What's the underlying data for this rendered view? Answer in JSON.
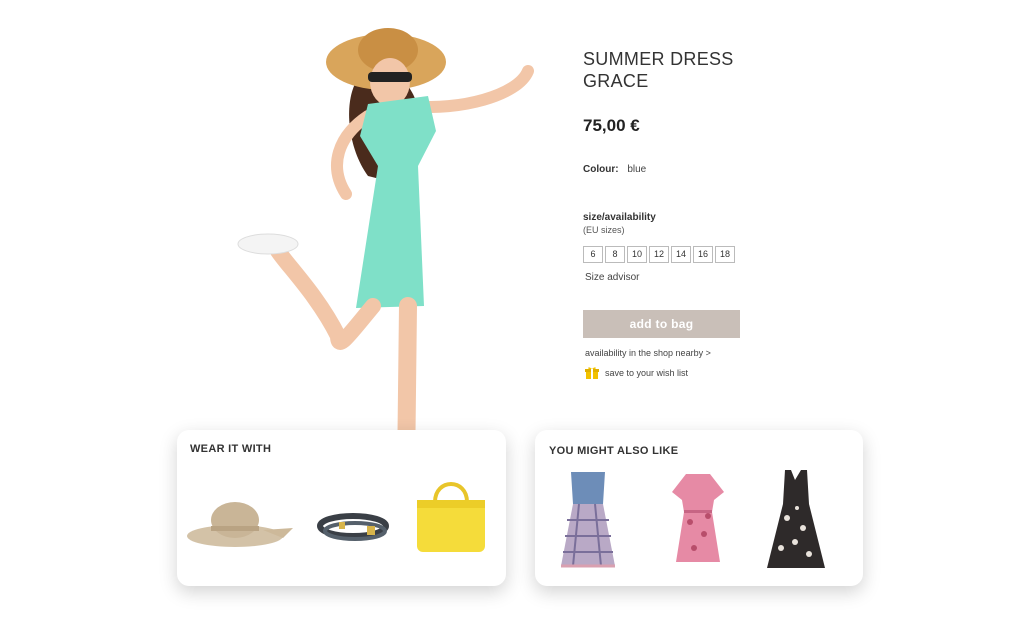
{
  "product": {
    "title": "SUMMER DRESS\nGRACE",
    "price": "75,00 €",
    "colour_label": "Colour:",
    "colour_value": "blue",
    "size_title": "size/availability",
    "size_subtitle": "(EU sizes)",
    "sizes": [
      "6",
      "8",
      "10",
      "12",
      "14",
      "16",
      "18"
    ],
    "size_advisor": "Size advisor",
    "add_to_bag": "add to bag",
    "availability_link": "availability in the shop nearby  >",
    "wish_list": "save to your wish list"
  },
  "wear_it_with": {
    "title": "WEAR IT WITH",
    "items": [
      {
        "icon": "straw-hat-icon"
      },
      {
        "icon": "belt-icon"
      },
      {
        "icon": "yellow-handbag-icon"
      }
    ]
  },
  "you_might_also_like": {
    "title": "YOU MIGHT ALSO LIKE",
    "items": [
      {
        "icon": "plaid-strapless-dress-icon"
      },
      {
        "icon": "pink-floral-dress-icon"
      },
      {
        "icon": "black-floral-dress-icon"
      }
    ]
  },
  "colors": {
    "button_bg": "#c9bfb8",
    "dress": "#7fe0c8",
    "wish_icon": "#f2c200",
    "handbag": "#f5dc3a"
  }
}
